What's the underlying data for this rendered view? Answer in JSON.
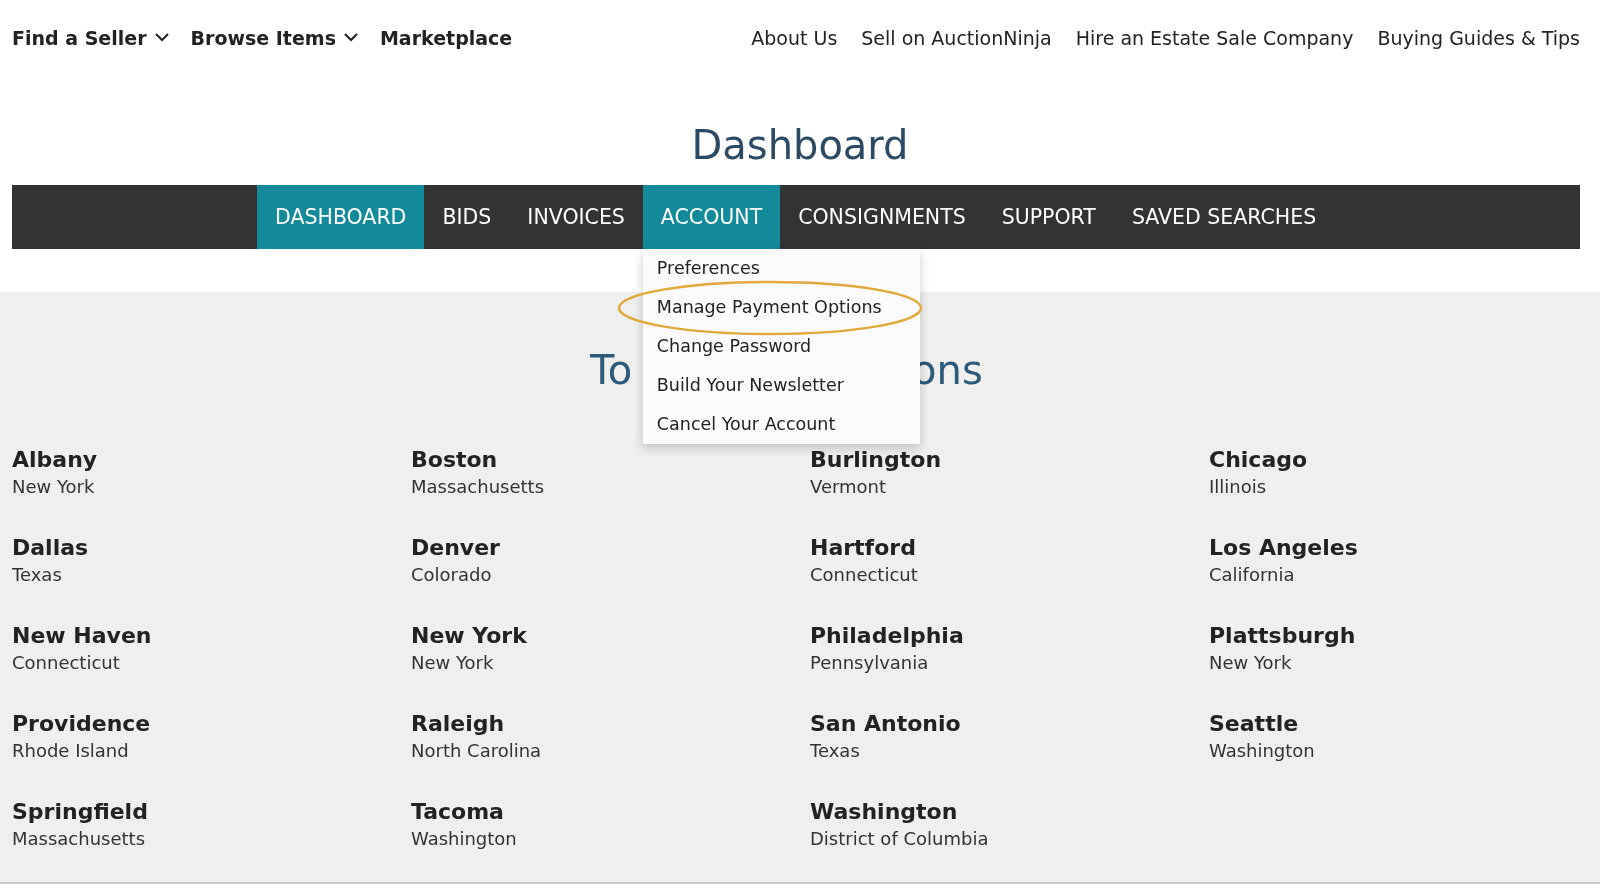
{
  "top_nav": {
    "left": [
      {
        "label": "Find a Seller",
        "dropdown": true
      },
      {
        "label": "Browse Items",
        "dropdown": true
      },
      {
        "label": "Marketplace",
        "dropdown": false
      }
    ],
    "right": [
      "About Us",
      "Sell on AuctionNinja",
      "Hire an Estate Sale Company",
      "Buying Guides & Tips"
    ]
  },
  "title": "Dashboard",
  "tabs": [
    {
      "label": "DASHBOARD",
      "selected": true
    },
    {
      "label": "BIDS",
      "selected": false
    },
    {
      "label": "INVOICES",
      "selected": false
    },
    {
      "label": "ACCOUNT",
      "selected": true,
      "menu_open": true
    },
    {
      "label": "CONSIGNMENTS",
      "selected": false
    },
    {
      "label": "SUPPORT",
      "selected": false
    },
    {
      "label": "SAVED SEARCHES",
      "selected": false
    }
  ],
  "account_menu": [
    {
      "label": "Preferences",
      "highlighted": false
    },
    {
      "label": "Manage Payment Options",
      "highlighted": true
    },
    {
      "label": "Change Password",
      "highlighted": false
    },
    {
      "label": "Build Your Newsletter",
      "highlighted": false
    },
    {
      "label": "Cancel Your Account",
      "highlighted": false
    }
  ],
  "locations_heading": {
    "left_part": "To",
    "right_part": "ons"
  },
  "locations": [
    {
      "city": "Albany",
      "state": "New York"
    },
    {
      "city": "Boston",
      "state": "Massachusetts"
    },
    {
      "city": "Burlington",
      "state": "Vermont"
    },
    {
      "city": "Chicago",
      "state": "Illinois"
    },
    {
      "city": "Dallas",
      "state": "Texas"
    },
    {
      "city": "Denver",
      "state": "Colorado"
    },
    {
      "city": "Hartford",
      "state": "Connecticut"
    },
    {
      "city": "Los Angeles",
      "state": "California"
    },
    {
      "city": "New Haven",
      "state": "Connecticut"
    },
    {
      "city": "New York",
      "state": "New York"
    },
    {
      "city": "Philadelphia",
      "state": "Pennsylvania"
    },
    {
      "city": "Plattsburgh",
      "state": "New York"
    },
    {
      "city": "Providence",
      "state": "Rhode Island"
    },
    {
      "city": "Raleigh",
      "state": "North Carolina"
    },
    {
      "city": "San Antonio",
      "state": "Texas"
    },
    {
      "city": "Seattle",
      "state": "Washington"
    },
    {
      "city": "Springfield",
      "state": "Massachusetts"
    },
    {
      "city": "Tacoma",
      "state": "Washington"
    },
    {
      "city": "Washington",
      "state": "District of Columbia"
    }
  ]
}
